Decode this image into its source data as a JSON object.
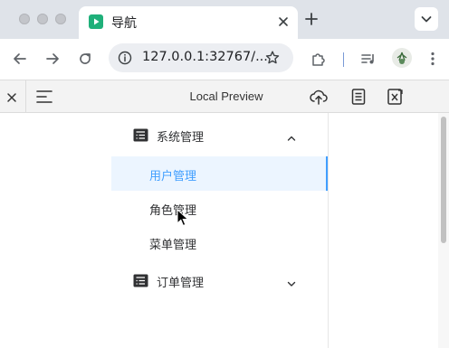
{
  "browser": {
    "tab": {
      "title": "导航",
      "favicon": "play-favicon-icon"
    },
    "address_bar": {
      "url": "127.0.0.1:32767/..."
    }
  },
  "preview_bar": {
    "title": "Local Preview"
  },
  "nav": {
    "groups": [
      {
        "label": "系统管理",
        "icon": "document-icon",
        "expanded": true,
        "items": [
          {
            "label": "用户管理",
            "active": true
          },
          {
            "label": "角色管理",
            "active": false
          },
          {
            "label": "菜单管理",
            "active": false
          }
        ]
      },
      {
        "label": "订单管理",
        "icon": "document-icon",
        "expanded": false,
        "items": []
      }
    ]
  },
  "colors": {
    "accent": "#409eff",
    "active_background": "#ecf5ff",
    "text": "#303133",
    "tab_strip": "#dfe3e9",
    "favicon": "#1fb07a"
  }
}
